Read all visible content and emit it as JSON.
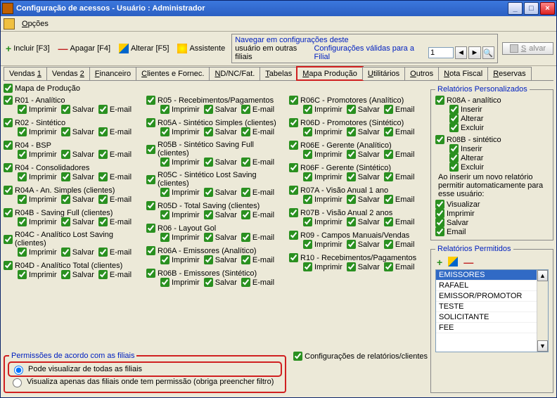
{
  "window": {
    "title": "Configuração de acessos - Usuário : Administrador"
  },
  "menu": {
    "opcoes": "Opções"
  },
  "toolbar": {
    "incluir": "Incluir [F3]",
    "apagar": "Apagar [F4]",
    "alterar": "Alterar [F5]",
    "assistente": "Assistente",
    "salvar": "Salvar",
    "nav_line1": "Navegar em configurações deste",
    "nav_prefix": "usuário em outras filiais",
    "nav_link": "Configurações válidas para a Filial",
    "filial_value": "1"
  },
  "tabs": [
    {
      "label": "Vendas 1",
      "u": "1"
    },
    {
      "label": "Vendas 2",
      "u": "2"
    },
    {
      "label": "Financeiro",
      "u": "F"
    },
    {
      "label": "Clientes e Fornec.",
      "u": "C"
    },
    {
      "label": "ND/NC/Fat.",
      "u": "N"
    },
    {
      "label": "Tabelas",
      "u": "T"
    },
    {
      "label": "Mapa Produção",
      "u": "M",
      "active": true
    },
    {
      "label": "Utilitários",
      "u": "U"
    },
    {
      "label": "Outros",
      "u": "O"
    },
    {
      "label": "Nota Fiscal",
      "u": "N"
    },
    {
      "label": "Reservas",
      "u": "R"
    }
  ],
  "top_cb": "Mapa de Produção",
  "actions": {
    "imprimir": "Imprimir",
    "salvar": "Salvar",
    "email": "E-mail",
    "email2": "Email"
  },
  "col1": [
    "R01 - Analítico",
    "R02 - Sintético",
    "R04 - BSP",
    "R04 - Consolidadores",
    "R04A - An. Simples (clientes)",
    "R04B - Saving Full (clientes)",
    "R04C - Analítico Lost Saving (clientes)",
    "R04D - Analítico Total (clientes)"
  ],
  "col2": [
    "R05 - Recebimentos/Pagamentos",
    "R05A - Sintético Simples (clientes)",
    "R05B - Sintético Saving Full (clientes)",
    "R05C - Sintético Lost Saving (clientes)",
    "R05D - Total Saving (clientes)",
    "R06 - Layout Gol",
    "R06A - Emissores (Analítico)",
    "R06B - Emissores (Sintético)"
  ],
  "col3": [
    "R06C - Promotores (Analítico)",
    "R06D - Promotores (Sintético)",
    "R06E - Gerente (Analítico)",
    "R06F - Gerente (Sintético)",
    "R07A - Visão Anual 1 ano",
    "R07B - Visão Anual 2 anos",
    "R09 - Campos Manuais/Vendas",
    "R10 - Recebimentos/Pagamentos"
  ],
  "config_rel": "Configurações de relatórios/clientes",
  "perm_filiais": {
    "legend": "Permissões de acordo com as filiais",
    "opt1": "Pode visualizar de todas as filiais",
    "opt2": "Visualiza apenas das filiais onde tem permissão (obriga preencher filtro)"
  },
  "side": {
    "personalizados": {
      "legend": "Relatórios Personalizados",
      "r08a": {
        "title": "R08A - analítico",
        "inserir": "Inserir",
        "alterar": "Alterar",
        "excluir": "Excluir"
      },
      "r08b": {
        "title": "R08B - sintético",
        "inserir": "Inserir",
        "alterar": "Alterar",
        "excluir": "Excluir"
      },
      "hint": "Ao inserir um novo relatório permitir automaticamente para esse usuário:",
      "auto": {
        "visualizar": "Visualizar",
        "imprimir": "Imprimir",
        "salvar": "Salvar",
        "email": "Email"
      }
    },
    "permitidos": {
      "legend": "Relatórios Permitidos",
      "items": [
        "EMISSORES",
        "RAFAEL",
        "EMISSOR/PROMOTOR",
        "TESTE",
        "SOLICITANTE",
        "FEE"
      ]
    }
  }
}
